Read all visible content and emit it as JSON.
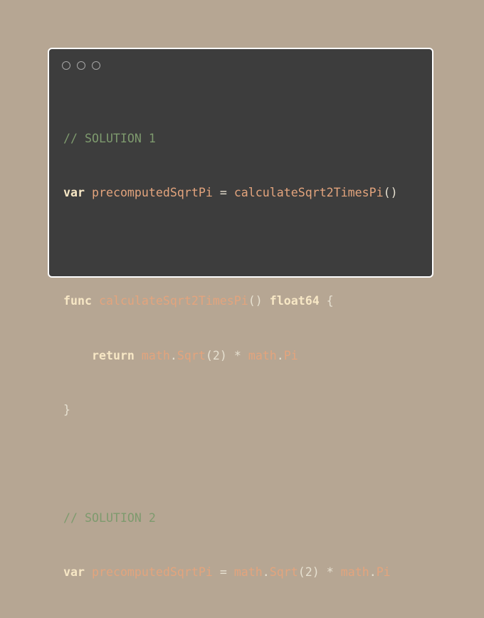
{
  "window": {
    "controls": [
      "circle-icon",
      "circle-icon",
      "circle-icon"
    ]
  },
  "code": {
    "comment1": "// SOLUTION 1",
    "kw_var": "var",
    "ident_precomputed": "precomputedSqrtPi",
    "op_eq": " = ",
    "ident_calc": "calculateSqrt2TimesPi",
    "parens": "()",
    "kw_func": "func",
    "type_float64": "float64",
    "brace_open": " {",
    "kw_return": "return",
    "ident_math": "math",
    "dot": ".",
    "ident_sqrt": "Sqrt",
    "arg_open": "(2)",
    "op_mul": " * ",
    "ident_pi": "Pi",
    "brace_close": "}",
    "comment2": "// SOLUTION 2"
  },
  "colors": {
    "background": "#b6a693",
    "editor": "#3d3d3d",
    "comment": "#7e9a6e",
    "keyword": "#f7e7c5",
    "identifier": "#e3a47d",
    "text": "#e6e0d0"
  }
}
